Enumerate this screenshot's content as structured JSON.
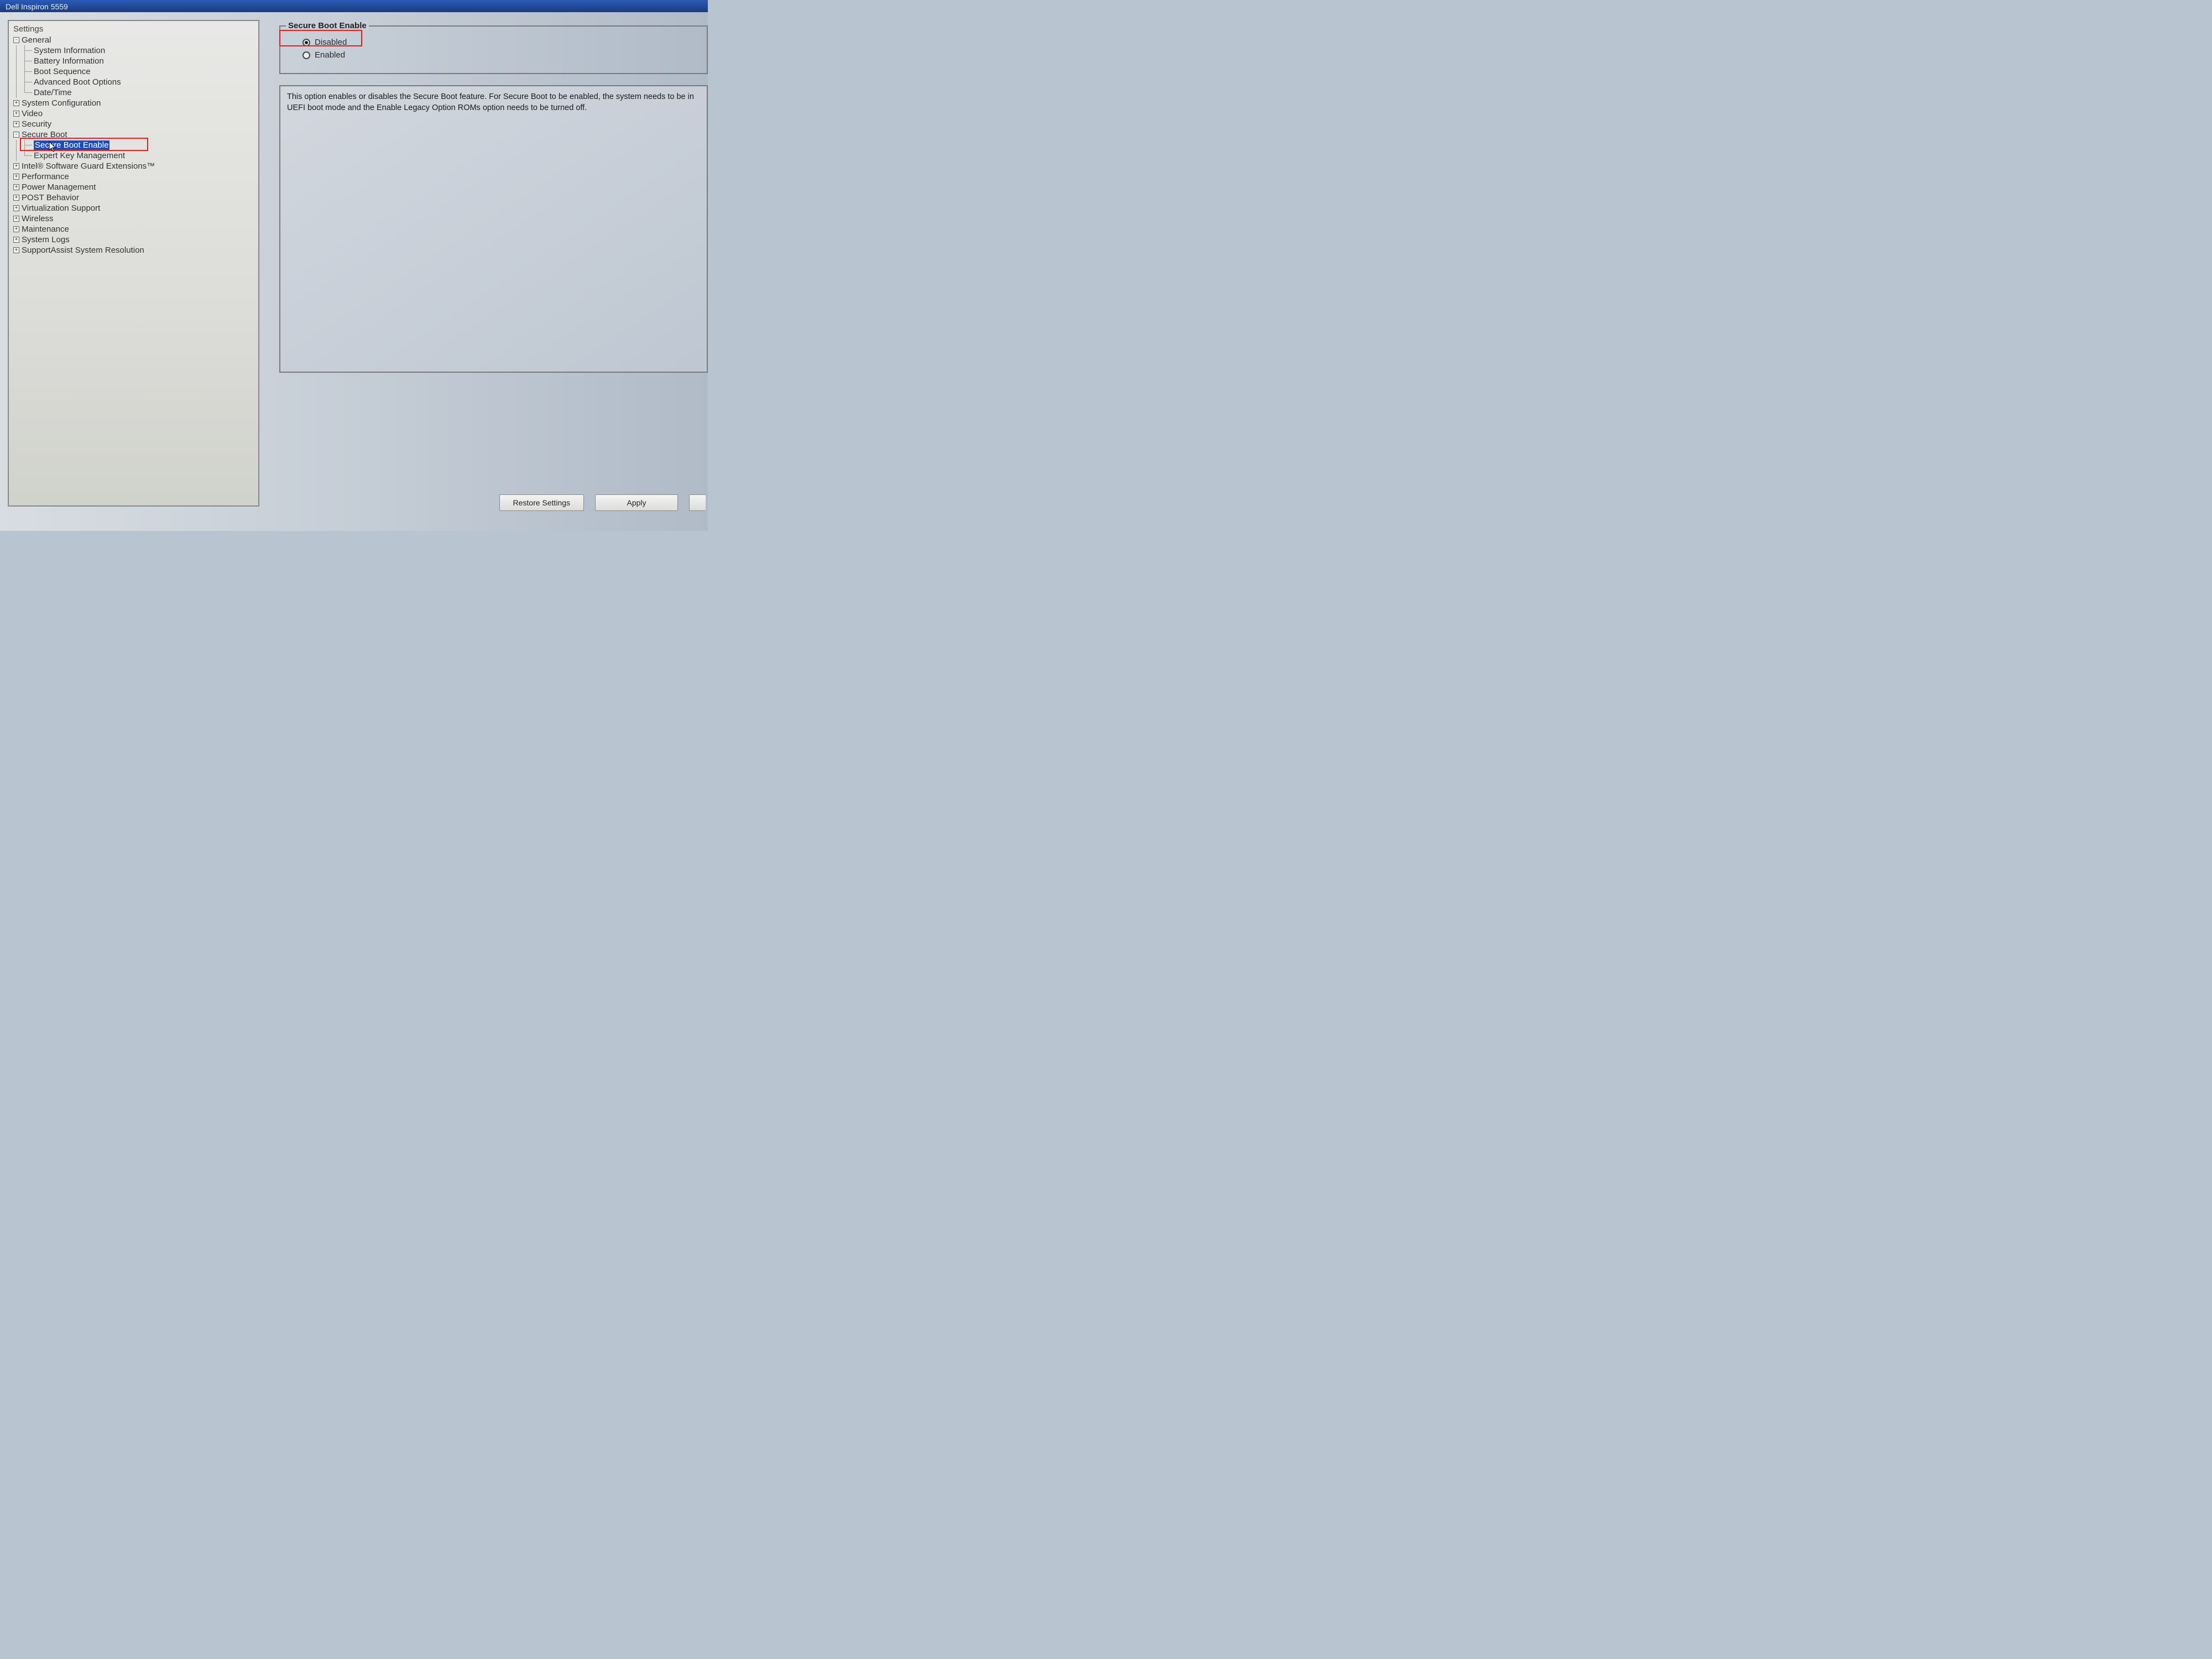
{
  "titlebar": "Dell Inspiron 5559",
  "settings_label": "Settings",
  "tree": {
    "general": {
      "label": "General",
      "expanded": true,
      "children": [
        "System Information",
        "Battery Information",
        "Boot Sequence",
        "Advanced Boot Options",
        "Date/Time"
      ]
    },
    "system_config": "System Configuration",
    "video": "Video",
    "security": "Security",
    "secure_boot": {
      "label": "Secure Boot",
      "expanded": true,
      "children": [
        "Secure Boot Enable",
        "Expert Key Management"
      ]
    },
    "sgx": "Intel® Software Guard Extensions™",
    "performance": "Performance",
    "power": "Power Management",
    "post": "POST Behavior",
    "virt": "Virtualization Support",
    "wireless": "Wireless",
    "maintenance": "Maintenance",
    "syslogs": "System Logs",
    "supportassist": "SupportAssist System Resolution"
  },
  "right": {
    "legend": "Secure Boot Enable",
    "options": {
      "disabled": "Disabled",
      "enabled": "Enabled"
    },
    "selected": "disabled",
    "description": "This option enables or disables the Secure Boot feature. For Secure Boot to be enabled, the system needs to be in UEFI boot mode and the Enable Legacy Option ROMs option needs to be turned off."
  },
  "buttons": {
    "restore": "Restore Settings",
    "apply": "Apply"
  },
  "colors": {
    "selection_bg": "#1a4fb8",
    "highlight_border": "#e02020"
  }
}
